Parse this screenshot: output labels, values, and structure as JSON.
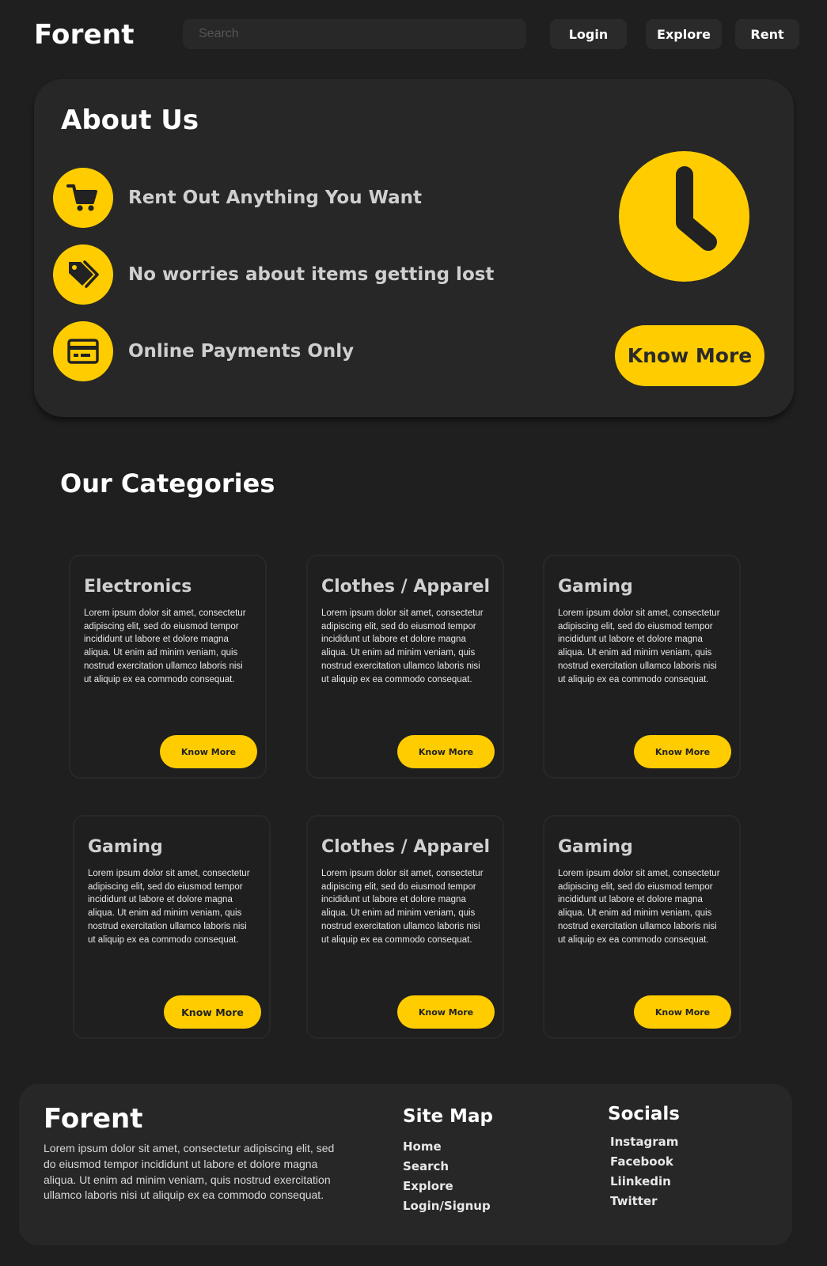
{
  "header": {
    "logo": "Forent",
    "search_placeholder": "Search",
    "nav": {
      "login": "Login",
      "explore": "Explore",
      "rent": "Rent"
    }
  },
  "about": {
    "title": "About Us",
    "features": [
      {
        "icon": "cart-icon",
        "text": "Rent Out Anything You Want"
      },
      {
        "icon": "tag-icon",
        "text": "No worries about items getting lost"
      },
      {
        "icon": "credit-card-icon",
        "text": "Online Payments Only"
      }
    ],
    "illustration": "clock-icon",
    "cta": "Know More"
  },
  "categories": {
    "title": "Our Categories",
    "cards": [
      {
        "title": "Electronics",
        "body": "Lorem ipsum dolor sit amet, consectetur adipiscing elit, sed do eiusmod tempor incididunt ut labore et dolore magna aliqua. Ut enim ad minim veniam, quis nostrud exercitation ullamco laboris nisi ut aliquip ex ea commodo consequat.",
        "button": "Know More"
      },
      {
        "title": "Clothes / Apparel",
        "body": "Lorem ipsum dolor sit amet, consectetur adipiscing elit, sed do eiusmod tempor incididunt ut labore et dolore magna aliqua. Ut enim ad minim veniam, quis nostrud exercitation ullamco laboris nisi ut aliquip ex ea commodo consequat.",
        "button": "Know More"
      },
      {
        "title": "Gaming",
        "body": "Lorem ipsum dolor sit amet, consectetur adipiscing elit, sed do eiusmod tempor incididunt ut labore et dolore magna aliqua. Ut enim ad minim veniam, quis nostrud exercitation ullamco laboris nisi ut aliquip ex ea commodo consequat.",
        "button": "Know More"
      },
      {
        "title": "Gaming",
        "body": "Lorem ipsum dolor sit amet, consectetur adipiscing elit, sed do eiusmod tempor incididunt ut labore et dolore magna aliqua. Ut enim ad minim veniam, quis nostrud exercitation ullamco laboris nisi ut aliquip ex ea commodo consequat.",
        "button": "Know More"
      },
      {
        "title": "Clothes / Apparel",
        "body": "Lorem ipsum dolor sit amet, consectetur adipiscing elit, sed do eiusmod tempor incididunt ut labore et dolore magna aliqua. Ut enim ad minim veniam, quis nostrud exercitation ullamco laboris nisi ut aliquip ex ea commodo consequat.",
        "button": "Know More"
      },
      {
        "title": "Gaming",
        "body": "Lorem ipsum dolor sit amet, consectetur adipiscing elit, sed do eiusmod tempor incididunt ut labore et dolore magna aliqua. Ut enim ad minim veniam, quis nostrud exercitation ullamco laboris nisi ut aliquip ex ea commodo consequat.",
        "button": "Know More"
      }
    ]
  },
  "footer": {
    "logo": "Forent",
    "description": "Lorem ipsum dolor sit amet, consectetur adipiscing elit, sed do eiusmod tempor incididunt ut labore et dolore magna aliqua. Ut enim ad minim veniam, quis nostrud exercitation ullamco laboris nisi ut aliquip ex ea commodo consequat.",
    "sitemap": {
      "title": "Site Map",
      "links": [
        "Home",
        "Search",
        "Explore",
        "Login/Signup"
      ]
    },
    "socials": {
      "title": "Socials",
      "links": [
        "Instagram",
        "Facebook",
        "Liinkedin",
        "Twitter"
      ]
    }
  },
  "colors": {
    "background": "#1f1f1f",
    "panel": "#272727",
    "accent": "#ffcc00"
  }
}
